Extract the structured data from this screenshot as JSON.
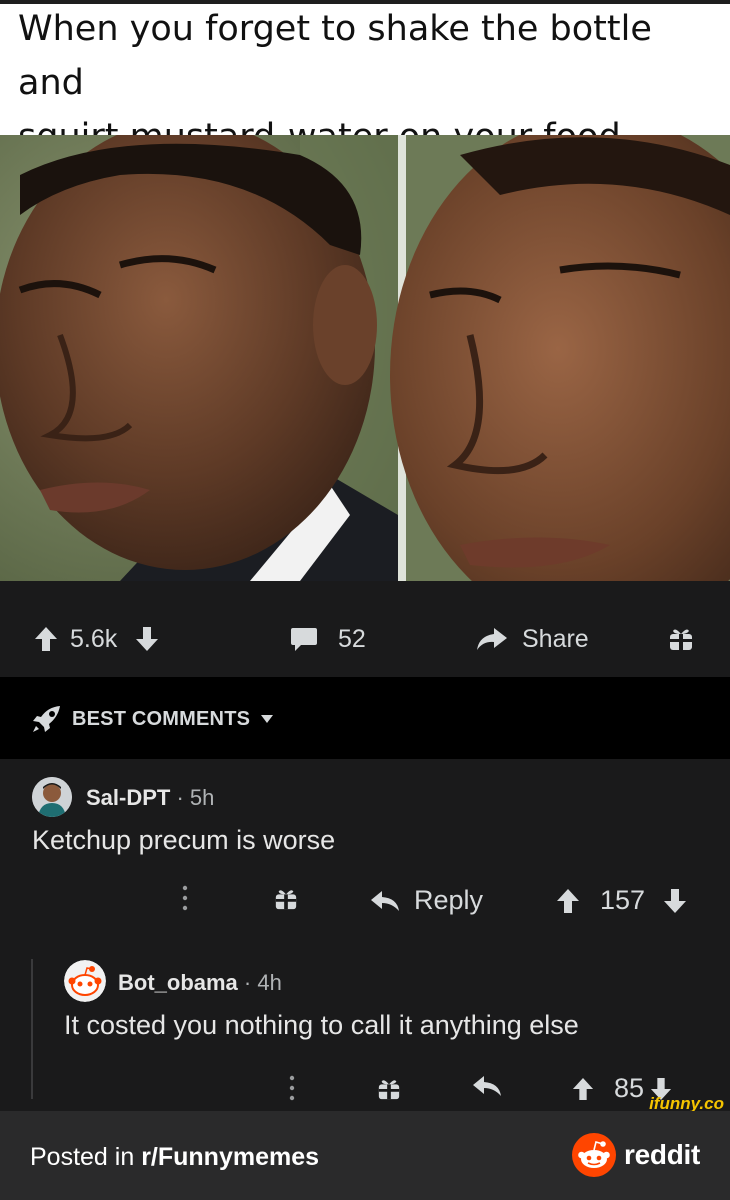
{
  "caption": {
    "line1": "When you forget to shake the bottle and",
    "line2": "squirt mustard-water on your food"
  },
  "post_actions": {
    "score": "5.6k",
    "comments": "52",
    "share_label": "Share"
  },
  "comments_header": {
    "label": "BEST COMMENTS"
  },
  "comments": [
    {
      "username": "Sal-DPT",
      "time": "5h",
      "text": "Ketchup precum is worse",
      "reply_label": "Reply",
      "score": "157"
    },
    {
      "username": "Bot_obama",
      "time": "4h",
      "text": "It costed you nothing to call it anything else",
      "score": "85"
    }
  ],
  "footer": {
    "posted_prefix": "Posted in ",
    "subreddit": "r/Funnymemes",
    "brand": "reddit"
  },
  "watermark": "ifunny.co",
  "colors": {
    "background": "#1a1a1b",
    "header_bar": "#000000",
    "footer": "#2a2a2b",
    "reddit_orange": "#ff4500",
    "watermark": "#f5c400"
  },
  "icons": [
    "upvote-icon",
    "downvote-icon",
    "comment-icon",
    "share-icon",
    "award-icon",
    "rocket-icon",
    "chevron-down-icon",
    "more-icon",
    "reply-icon",
    "reddit-logo"
  ]
}
